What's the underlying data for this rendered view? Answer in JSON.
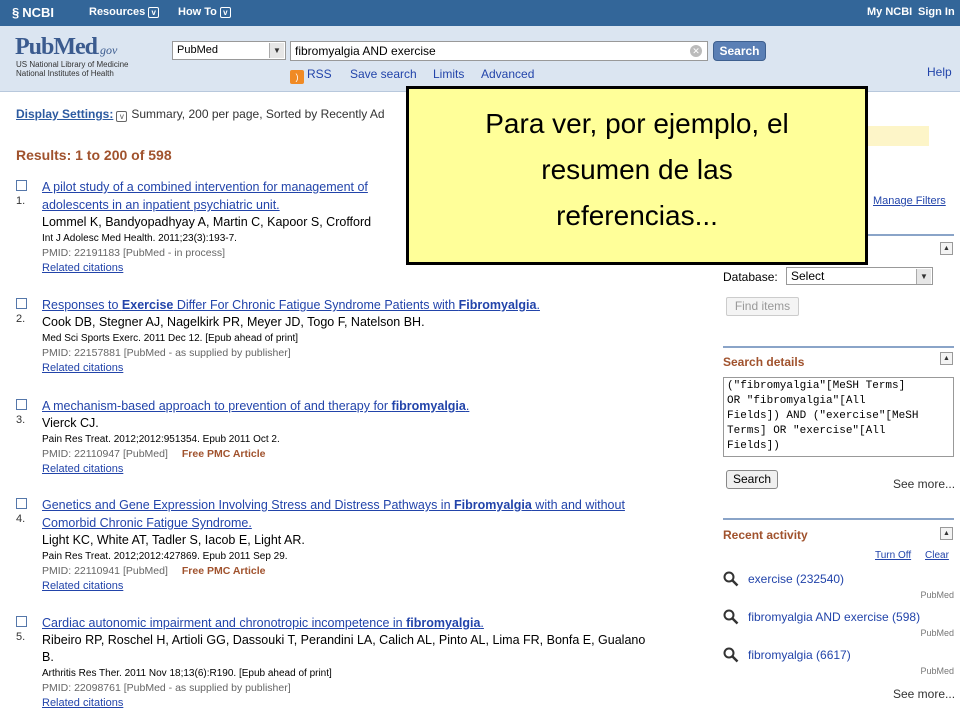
{
  "topbar": {
    "logo": "NCBI",
    "resources": "Resources",
    "howto": "How To",
    "my_ncbi": "My NCBI",
    "sign_in": "Sign In"
  },
  "header": {
    "logo_main": "PubMed",
    "logo_gov": ".gov",
    "subtitle_line1": "US National Library of Medicine",
    "subtitle_line2": "National Institutes of Health",
    "database": "PubMed",
    "query": "fibromyalgia AND exercise",
    "search_button": "Search",
    "rss": "RSS",
    "save_search": "Save search",
    "limits": "Limits",
    "advanced": "Advanced",
    "help": "Help"
  },
  "display_settings": {
    "label": "Display Settings:",
    "value": "Summary, 200 per page, Sorted by Recently Ad"
  },
  "results_count": "Results: 1 to 200 of 598",
  "results": [
    {
      "num": "1.",
      "title": "A pilot study of a combined intervention for management of",
      "title2": "adolescents in an inpatient psychiatric unit.",
      "authors": "Lommel K, Bandyopadhyay A, Martin C, Kapoor S, Crofford",
      "journal": "Int J Adolesc Med Health. 2011;23(3):193-7.",
      "pmid": "PMID: 22191183 [PubMed - in process]",
      "related": "Related citations"
    },
    {
      "num": "2.",
      "title_a": "Responses to ",
      "title_b": "Exercise",
      "title_c": " Differ For Chronic Fatigue Syndrome Patients with ",
      "title_d": "Fibromyalgia",
      "title_e": ".",
      "authors": "Cook DB, Stegner AJ, Nagelkirk PR, Meyer JD, Togo F, Natelson BH.",
      "journal": "Med Sci Sports Exerc. 2011 Dec 12. [Epub ahead of print]",
      "pmid": "PMID: 22157881 [PubMed - as supplied by publisher]",
      "related": "Related citations"
    },
    {
      "num": "3.",
      "title_a": "A mechanism-based approach to prevention of and therapy for ",
      "title_b": "fibromyalgia",
      "title_c": ".",
      "authors": "Vierck CJ.",
      "journal": "Pain Res Treat. 2012;2012:951354. Epub 2011 Oct 2.",
      "pmid": "PMID: 22110947 [PubMed]",
      "free": "Free PMC Article",
      "related": "Related citations"
    },
    {
      "num": "4.",
      "title_a": "Genetics and Gene Expression Involving Stress and Distress Pathways in ",
      "title_b": "Fibromyalgia",
      "title_c": " with and without",
      "title2": "Comorbid Chronic Fatigue Syndrome.",
      "authors": "Light KC, White AT, Tadler S, Iacob E, Light AR.",
      "journal": "Pain Res Treat. 2012;2012:427869. Epub 2011 Sep 29.",
      "pmid": "PMID: 22110941 [PubMed]",
      "free": "Free PMC Article",
      "related": "Related citations"
    },
    {
      "num": "5.",
      "title_a": "Cardiac autonomic impairment and chronotropic incompetence in ",
      "title_b": "fibromyalgia",
      "title_c": ".",
      "authors": "Ribeiro RP, Roschel H, Artioli GG, Dassouki T, Perandini LA, Calich AL, Pinto AL, Lima FR, Bonfa E, Gualano",
      "authors2": "B.",
      "journal": "Arthritis Res Ther. 2011 Nov 18;13(6):R190. [Epub ahead of print]",
      "pmid": "PMID: 22098761 [PubMed - as supplied by publisher]",
      "related": "Related citations"
    }
  ],
  "sidebar": {
    "manage_filters": "Manage Filters",
    "database_label": "Database:",
    "database_value": "Select",
    "find_items": "Find items",
    "search_details_title": "Search details",
    "search_details_text": "(\"fibromyalgia\"[MeSH Terms]\nOR \"fibromyalgia\"[All\nFields]) AND (\"exercise\"[MeSH\nTerms] OR \"exercise\"[All\nFields])",
    "search_button": "Search",
    "see_more": "See more...",
    "recent_activity_title": "Recent activity",
    "turn_off": "Turn Off",
    "clear": "Clear",
    "recent": [
      {
        "text": "exercise (232540)",
        "source": "PubMed"
      },
      {
        "text": "fibromyalgia AND exercise (598)",
        "source": "PubMed"
      },
      {
        "text": "fibromyalgia (6617)",
        "source": "PubMed"
      }
    ],
    "see_more2": "See more..."
  },
  "callout": {
    "line1": "Para ver, por ejemplo, el",
    "line2": "resumen de las",
    "line3": "referencias..."
  }
}
